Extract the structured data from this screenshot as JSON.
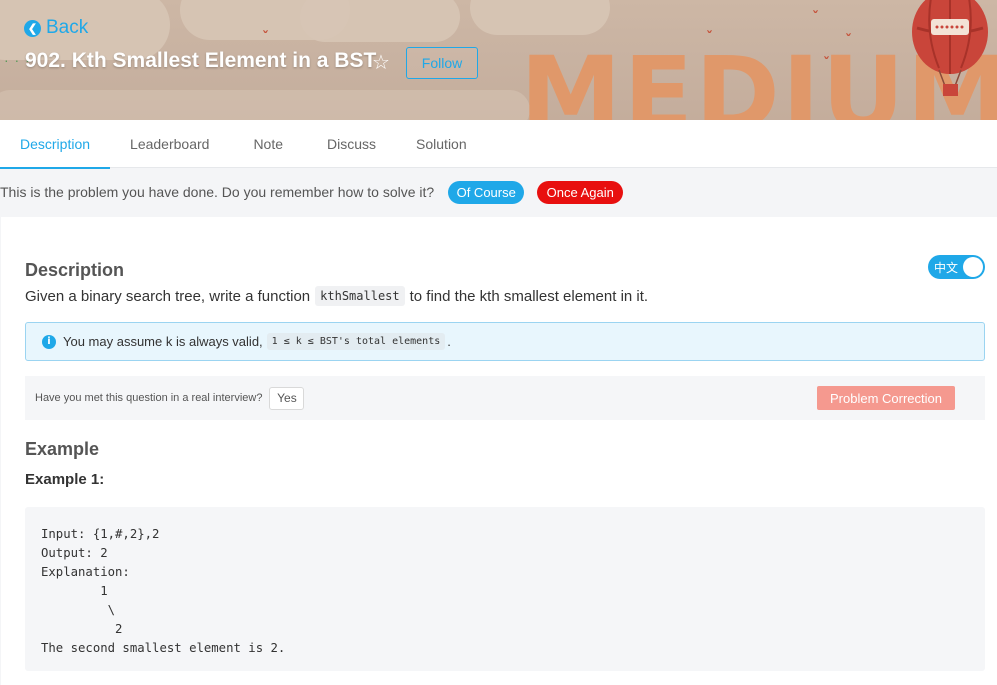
{
  "header": {
    "back_label": "Back",
    "problem_title": "902. Kth Smallest Element in a BST",
    "follow_label": "Follow",
    "difficulty_word": "MEDIUM",
    "star_icon": "star-outline-icon",
    "back_icon": "chevron-left-circle-icon"
  },
  "tabs": [
    {
      "label": "Description",
      "active": true
    },
    {
      "label": "Leaderboard",
      "active": false
    },
    {
      "label": "Note",
      "active": false
    },
    {
      "label": "Discuss",
      "active": false
    },
    {
      "label": "Solution",
      "active": false
    }
  ],
  "done_bar": {
    "message": "This is the problem you have done. Do you remember how to solve it?",
    "of_course_label": "Of Course",
    "once_again_label": "Once Again"
  },
  "content": {
    "description_heading": "Description",
    "language_toggle_label": "中文",
    "description_pre": "Given a binary search tree, write a function",
    "description_code": "kthSmallest",
    "description_post": "to find the kth smallest element in it.",
    "info_text": "You may assume k is always valid,",
    "info_code": "1 ≤ k ≤ BST's total elements",
    "info_suffix": ".",
    "interview_question": "Have you met this question in a real interview?",
    "yes_label": "Yes",
    "correction_label": "Problem Correction",
    "example_heading": "Example",
    "example_sub": "Example 1:",
    "code_lines": [
      "Input: {1,#,2},2",
      "Output: 2",
      "Explanation:",
      "        1",
      "         \\",
      "          2",
      "The second smallest element is 2."
    ]
  },
  "colors": {
    "accent": "#1fa8e8",
    "danger": "#e8100f",
    "correction": "#f5998f",
    "difficulty_word": "#e0986a"
  }
}
